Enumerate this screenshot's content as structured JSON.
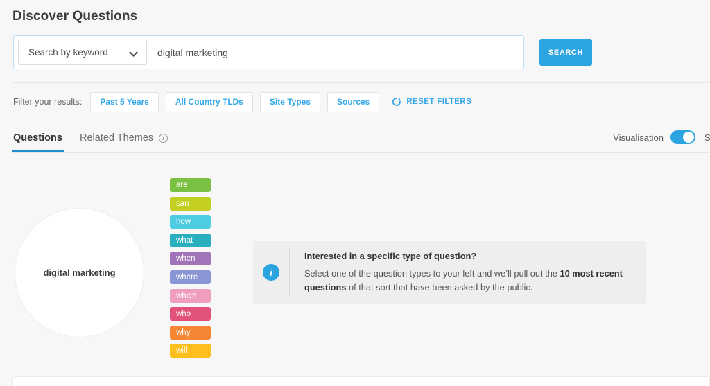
{
  "page": {
    "title": "Discover Questions",
    "background_color": "#f7f7f7",
    "accent_color": "#2ba4e0"
  },
  "search": {
    "select_label": "Search by keyword",
    "select_icon": "chevron-down-icon",
    "input_value": "digital marketing",
    "input_placeholder": "",
    "button_label": "SEARCH",
    "button_color": "#2ba4e0"
  },
  "filters": {
    "label": "Filter your results:",
    "chips": [
      {
        "label": "Past 5 Years"
      },
      {
        "label": "All Country TLDs"
      },
      {
        "label": "Site Types"
      },
      {
        "label": "Sources"
      }
    ],
    "reset": {
      "label": "RESET FILTERS",
      "icon": "refresh-icon",
      "color": "#36a8e8"
    }
  },
  "tabs": {
    "items": [
      {
        "label": "Questions",
        "active": true
      },
      {
        "label": "Related Themes",
        "active": false,
        "icon": "info-circle-icon"
      }
    ],
    "visualisation": {
      "label": "Visualisation",
      "toggle_on": true,
      "truncated_label": "S"
    }
  },
  "visualisation": {
    "keyword": "digital marketing",
    "question_words": [
      {
        "label": "are",
        "color": "#7ac143"
      },
      {
        "label": "can",
        "color": "#c3cf22"
      },
      {
        "label": "how",
        "color": "#4ecde2"
      },
      {
        "label": "what",
        "color": "#2aafbf"
      },
      {
        "label": "when",
        "color": "#a173b8"
      },
      {
        "label": "where",
        "color": "#8a96d4"
      },
      {
        "label": "which",
        "color": "#f09ec0"
      },
      {
        "label": "who",
        "color": "#e2527a"
      },
      {
        "label": "why",
        "color": "#f58634"
      },
      {
        "label": "will",
        "color": "#fcbf1c"
      }
    ]
  },
  "info_panel": {
    "icon": "info-circle-icon",
    "heading": "Interested in a specific type of question?",
    "body_part_1": "Select one of the question types to your left and we’ll pull out the ",
    "body_bold_1": "10 most recent questions",
    "body_part_2": " of that sort that have been asked by the public."
  }
}
